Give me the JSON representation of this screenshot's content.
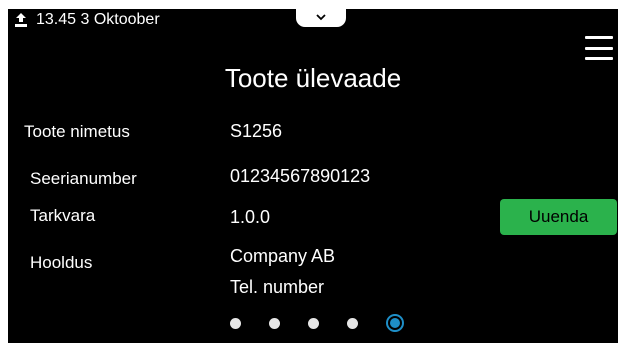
{
  "status_bar": {
    "icon": "upload-icon",
    "datetime": "13.45 3 Oktoober"
  },
  "pull_tab": {
    "icon": "chevron-down-icon"
  },
  "menu": {
    "icon": "hamburger-menu-icon"
  },
  "page": {
    "title": "Toote ülevaade"
  },
  "info": {
    "product_name": {
      "label": "Toote nimetus",
      "value": "S1256"
    },
    "serial_number": {
      "label": "Seerianumber",
      "value": "01234567890123"
    },
    "software": {
      "label": "Tarkvara",
      "value": "1.0.0",
      "button": "Uuenda"
    },
    "service": {
      "label": "Hooldus",
      "company": "Company AB",
      "phone": "Tel. number"
    }
  },
  "pagination": {
    "total": 5,
    "current": 5
  },
  "colors": {
    "background": "#000000",
    "text": "#ffffff",
    "button": "#2bb24c",
    "active_dot": "#1e8fc8"
  }
}
